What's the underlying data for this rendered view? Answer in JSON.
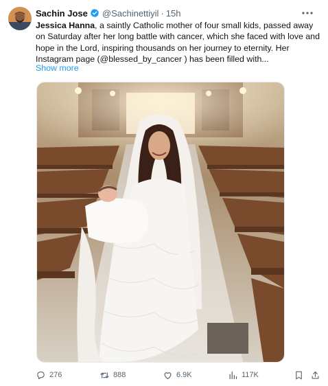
{
  "tweet": {
    "author_name": "Sachin Jose",
    "author_handle": "@Sachinettiyil",
    "separator": "·",
    "time": "15h",
    "text_name": "Jessica Hanna",
    "text_rest": ", a saintly Catholic mother of four small kids, passed away on Saturday after her long battle with cancer, which she faced with love and hope in the Lord, inspiring thousands on her journey to eternity. Her Instagram page (@blessed_by_cancer ) has been filled with...",
    "show_more": "Show more"
  },
  "icons": {
    "verified": "verified-badge-icon",
    "more": "more-dots-icon",
    "reply": "reply-icon",
    "retweet": "retweet-icon",
    "like": "heart-icon",
    "views": "views-bar-chart-icon",
    "bookmark": "bookmark-icon",
    "share": "share-icon"
  },
  "actions": {
    "replies": "276",
    "retweets": "888",
    "likes": "6.9K",
    "views": "117K"
  },
  "colors": {
    "accent": "#1d9bf0",
    "secondary_text": "#536471",
    "primary_text": "#0f1419"
  }
}
